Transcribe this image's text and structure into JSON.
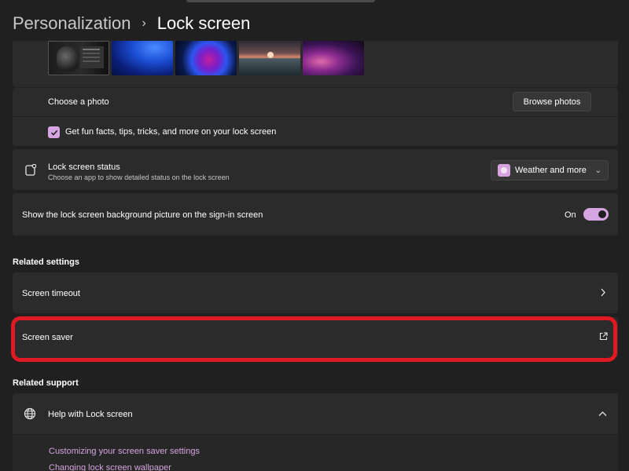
{
  "breadcrumb": {
    "parent": "Personalization",
    "separator": "›",
    "current": "Lock screen"
  },
  "photo": {
    "choose_label": "Choose a photo",
    "browse_button": "Browse photos",
    "fun_facts_label": "Get fun facts, tips, tricks, and more on your lock screen",
    "fun_facts_checked": true
  },
  "status": {
    "title": "Lock screen status",
    "description": "Choose an app to show detailed status on the lock screen",
    "selected": "Weather and more",
    "icon": "lock-screen-status-icon"
  },
  "signin": {
    "label": "Show the lock screen background picture on the sign-in screen",
    "toggle_label": "On",
    "toggle_on": true
  },
  "related_settings": {
    "title": "Related settings",
    "items": [
      {
        "label": "Screen timeout",
        "icon": "chevron-right-icon"
      },
      {
        "label": "Screen saver",
        "icon": "external-link-icon"
      }
    ]
  },
  "related_support": {
    "title": "Related support",
    "help": {
      "label": "Help with Lock screen",
      "icon": "globe-icon",
      "expanded": true
    },
    "links": [
      "Customizing your screen saver settings",
      "Changing lock screen wallpaper"
    ]
  },
  "colors": {
    "accent": "#d6a4e0",
    "highlight": "#e01a23",
    "background": "#202020",
    "card": "#2b2b2b"
  }
}
